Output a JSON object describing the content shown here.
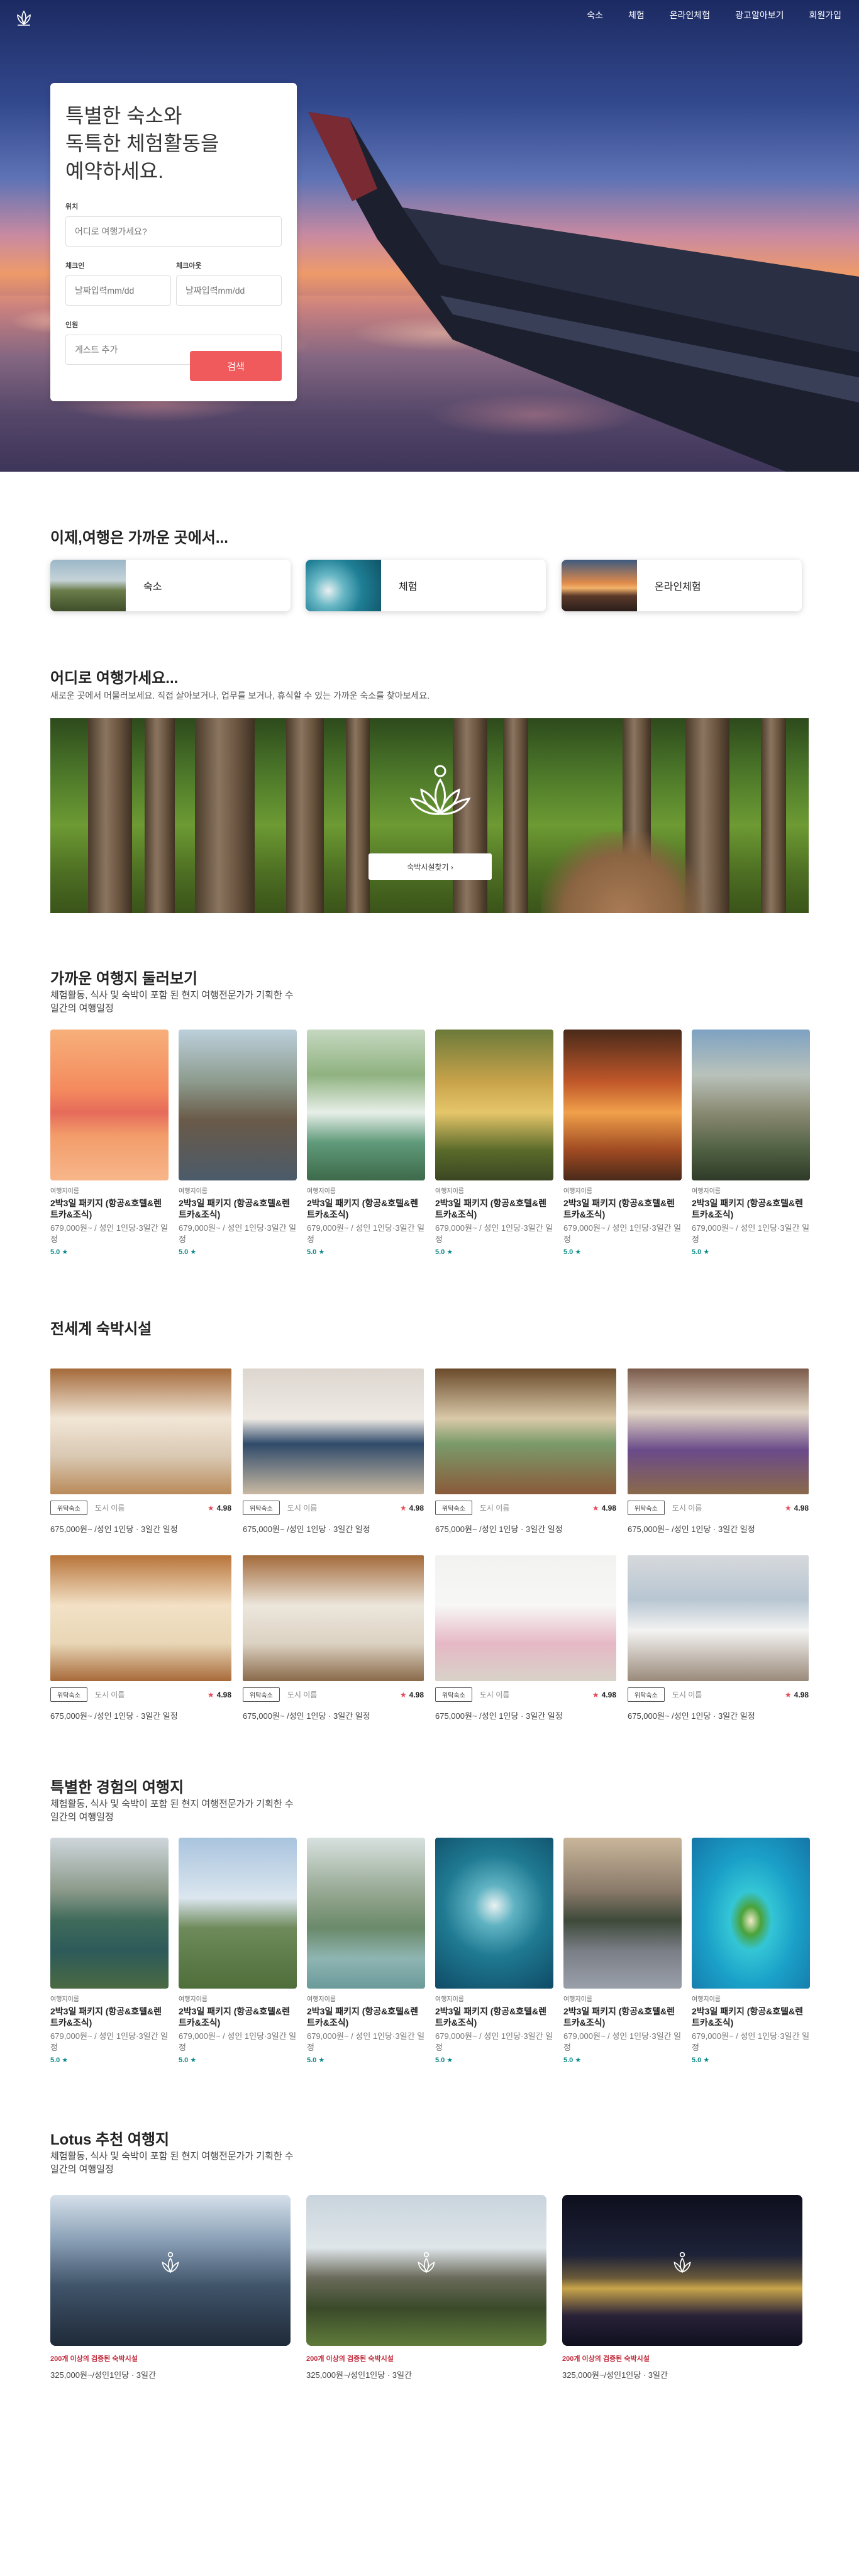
{
  "nav": {
    "items": [
      "숙소",
      "체험",
      "온라인체험",
      "광고알아보기",
      "회원가입"
    ]
  },
  "hero": {
    "headline": "특별한 숙소와\n독특한 체험활동을\n예약하세요.",
    "location_label": "위치",
    "location_placeholder": "어디로 여행가세요?",
    "checkin_label": "체크인",
    "checkin_placeholder": "날짜입력mm/dd",
    "checkout_label": "체크아웃",
    "checkout_placeholder": "날짜입력mm/dd",
    "guests_label": "인원",
    "guests_placeholder": "게스트 추가",
    "search_button": "검색"
  },
  "nearby": {
    "title": "이제,여행은 가까운 곳에서...",
    "categories": [
      "숙소",
      "체험",
      "온라인체험"
    ]
  },
  "where": {
    "title": "어디로 여행가세요...",
    "subtitle": "새로운 곳에서 머물러보세요. 직접 살아보거나, 업무를 보거나, 휴식할 수 있는 가까운 숙소를 찾아보세요.",
    "button": "숙박시설찾기 ›"
  },
  "explore": {
    "title": "가까운 여행지 둘러보기",
    "subtitle": "체험활동, 식사 및 숙박이 포함 된 현지 여행전문가가 기획한 수일간의 여행일정",
    "cards": [
      {
        "category": "여행지이름",
        "title": "2박3일 패키지 (항공&호텔&렌트카&조식)",
        "price": "679,000원~ / 성인 1인당·3일간 일정",
        "rating": "5.0 ★"
      },
      {
        "category": "여행지이름",
        "title": "2박3일 패키지 (항공&호텔&렌트카&조식)",
        "price": "679,000원~ / 성인 1인당·3일간 일정",
        "rating": "5.0 ★"
      },
      {
        "category": "여행지이름",
        "title": "2박3일 패키지 (항공&호텔&렌트카&조식)",
        "price": "679,000원~ / 성인 1인당·3일간 일정",
        "rating": "5.0 ★"
      },
      {
        "category": "여행지이름",
        "title": "2박3일 패키지 (항공&호텔&렌트카&조식)",
        "price": "679,000원~ / 성인 1인당·3일간 일정",
        "rating": "5.0 ★"
      },
      {
        "category": "여행지이름",
        "title": "2박3일 패키지 (항공&호텔&렌트카&조식)",
        "price": "679,000원~ / 성인 1인당·3일간 일정",
        "rating": "5.0 ★"
      },
      {
        "category": "여행지이름",
        "title": "2박3일 패키지 (항공&호텔&렌트카&조식)",
        "price": "679,000원~ / 성인 1인당·3일간 일정",
        "rating": "5.0 ★"
      }
    ]
  },
  "stays": {
    "title": "전세계 숙박시설",
    "cards": [
      {
        "badge": "위탁숙소",
        "city": "도시 이름",
        "rating": "4.98",
        "price": "675,000원~ /성인 1인당 · 3일간 일정"
      },
      {
        "badge": "위탁숙소",
        "city": "도시 이름",
        "rating": "4.98",
        "price": "675,000원~ /성인 1인당 · 3일간 일정"
      },
      {
        "badge": "위탁숙소",
        "city": "도시 이름",
        "rating": "4.98",
        "price": "675,000원~ /성인 1인당 · 3일간 일정"
      },
      {
        "badge": "위탁숙소",
        "city": "도시 이름",
        "rating": "4.98",
        "price": "675,000원~ /성인 1인당 · 3일간 일정"
      },
      {
        "badge": "위탁숙소",
        "city": "도시 이름",
        "rating": "4.98",
        "price": "675,000원~ /성인 1인당 · 3일간 일정"
      },
      {
        "badge": "위탁숙소",
        "city": "도시 이름",
        "rating": "4.98",
        "price": "675,000원~ /성인 1인당 · 3일간 일정"
      },
      {
        "badge": "위탁숙소",
        "city": "도시 이름",
        "rating": "4.98",
        "price": "675,000원~ /성인 1인당 · 3일간 일정"
      },
      {
        "badge": "위탁숙소",
        "city": "도시 이름",
        "rating": "4.98",
        "price": "675,000원~ /성인 1인당 · 3일간 일정"
      }
    ]
  },
  "special": {
    "title": "특별한 경험의 여행지",
    "subtitle": "체험활동, 식사 및 숙박이 포함 된 현지 여행전문가가 기획한 수일간의 여행일정",
    "cards": [
      {
        "category": "여행지이름",
        "title": "2박3일 패키지 (항공&호텔&렌트카&조식)",
        "price": "679,000원~ / 성인 1인당·3일간 일정",
        "rating": "5.0 ★"
      },
      {
        "category": "여행지이름",
        "title": "2박3일 패키지 (항공&호텔&렌트카&조식)",
        "price": "679,000원~ / 성인 1인당·3일간 일정",
        "rating": "5.0 ★"
      },
      {
        "category": "여행지이름",
        "title": "2박3일 패키지 (항공&호텔&렌트카&조식)",
        "price": "679,000원~ / 성인 1인당·3일간 일정",
        "rating": "5.0 ★"
      },
      {
        "category": "여행지이름",
        "title": "2박3일 패키지 (항공&호텔&렌트카&조식)",
        "price": "679,000원~ / 성인 1인당·3일간 일정",
        "rating": "5.0 ★"
      },
      {
        "category": "여행지이름",
        "title": "2박3일 패키지 (항공&호텔&렌트카&조식)",
        "price": "679,000원~ / 성인 1인당·3일간 일정",
        "rating": "5.0 ★"
      },
      {
        "category": "여행지이름",
        "title": "2박3일 패키지 (항공&호텔&렌트카&조식)",
        "price": "679,000원~ / 성인 1인당·3일간 일정",
        "rating": "5.0 ★"
      }
    ]
  },
  "lotus": {
    "title": "Lotus 추천 여행지",
    "subtitle": "체험활동, 식사 및 숙박이 포함 된 현지 여행전문가가 기획한 수일간의 여행일정",
    "cards": [
      {
        "tag": "200개 이상의 검증된 숙박시설",
        "price": "325,000원~/성인1인당 · 3일간"
      },
      {
        "tag": "200개 이상의 검증된 숙박시설",
        "price": "325,000원~/성인1인당 · 3일간"
      },
      {
        "tag": "200개 이상의 검증된 숙박시설",
        "price": "325,000원~/성인1인당 · 3일간"
      }
    ]
  },
  "colors": {
    "accent": "#f15a5c",
    "rating_teal": "#0a8a86",
    "tag_red": "#c0283a"
  }
}
